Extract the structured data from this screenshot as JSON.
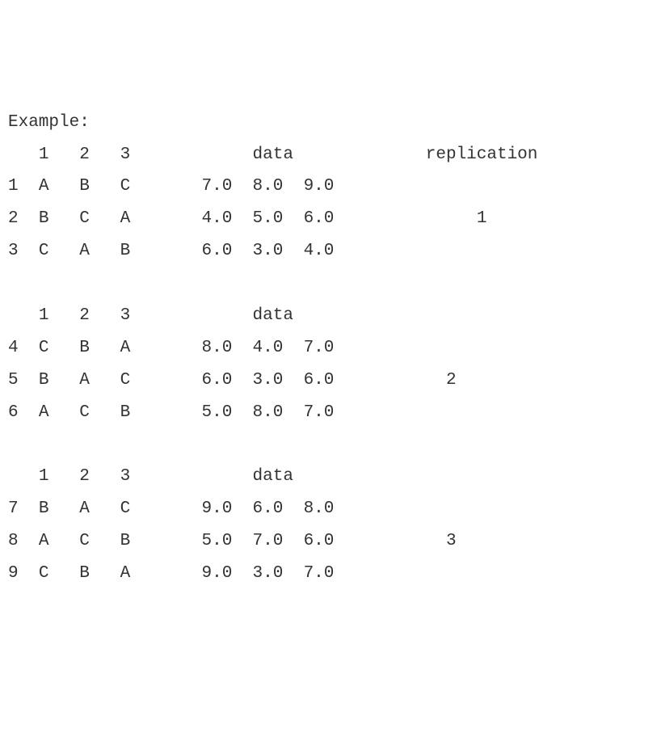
{
  "title": "Example:",
  "replication_label": "replication",
  "data_label": "data",
  "blocks": [
    {
      "replication": "1",
      "col_headers": [
        "1",
        "2",
        "3"
      ],
      "rows": [
        {
          "idx": "1",
          "design": [
            "A",
            "B",
            "C"
          ],
          "data": [
            "7.0",
            "8.0",
            "9.0"
          ]
        },
        {
          "idx": "2",
          "design": [
            "B",
            "C",
            "A"
          ],
          "data": [
            "4.0",
            "5.0",
            "6.0"
          ]
        },
        {
          "idx": "3",
          "design": [
            "C",
            "A",
            "B"
          ],
          "data": [
            "6.0",
            "3.0",
            "4.0"
          ]
        }
      ]
    },
    {
      "replication": "2",
      "col_headers": [
        "1",
        "2",
        "3"
      ],
      "rows": [
        {
          "idx": "4",
          "design": [
            "C",
            "B",
            "A"
          ],
          "data": [
            "8.0",
            "4.0",
            "7.0"
          ]
        },
        {
          "idx": "5",
          "design": [
            "B",
            "A",
            "C"
          ],
          "data": [
            "6.0",
            "3.0",
            "6.0"
          ]
        },
        {
          "idx": "6",
          "design": [
            "A",
            "C",
            "B"
          ],
          "data": [
            "5.0",
            "8.0",
            "7.0"
          ]
        }
      ]
    },
    {
      "replication": "3",
      "col_headers": [
        "1",
        "2",
        "3"
      ],
      "rows": [
        {
          "idx": "7",
          "design": [
            "B",
            "A",
            "C"
          ],
          "data": [
            "9.0",
            "6.0",
            "8.0"
          ]
        },
        {
          "idx": "8",
          "design": [
            "A",
            "C",
            "B"
          ],
          "data": [
            "5.0",
            "7.0",
            "6.0"
          ]
        },
        {
          "idx": "9",
          "design": [
            "C",
            "B",
            "A"
          ],
          "data": [
            "9.0",
            "3.0",
            "7.0"
          ]
        }
      ]
    }
  ]
}
